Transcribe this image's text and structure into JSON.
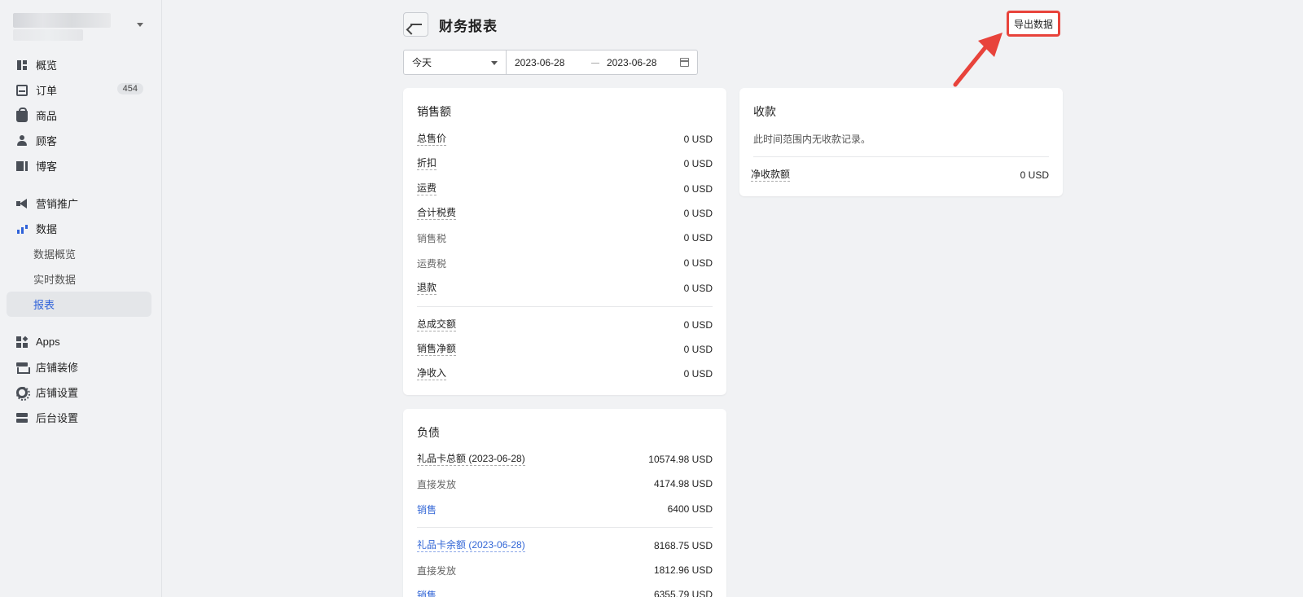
{
  "sidebar": {
    "badge_orders": "454",
    "items": [
      {
        "label": "概览"
      },
      {
        "label": "订单"
      },
      {
        "label": "商品"
      },
      {
        "label": "顾客"
      },
      {
        "label": "博客"
      },
      {
        "label": "营销推广"
      },
      {
        "label": "数据"
      },
      {
        "label": "数据概览"
      },
      {
        "label": "实时数据"
      },
      {
        "label": "报表"
      },
      {
        "label": "Apps"
      },
      {
        "label": "店铺装修"
      },
      {
        "label": "店铺设置"
      },
      {
        "label": "后台设置"
      }
    ]
  },
  "header": {
    "title": "财务报表",
    "export_label": "导出数据"
  },
  "filter": {
    "range": "今天",
    "start_date": "2023-06-28",
    "end_date": "2023-06-28"
  },
  "sales_card": {
    "title": "销售额",
    "rows": [
      {
        "label": "总售价",
        "value": "0 USD"
      },
      {
        "label": "折扣",
        "value": "0 USD"
      },
      {
        "label": "运费",
        "value": "0 USD"
      },
      {
        "label": "合计税费",
        "value": "0 USD"
      },
      {
        "label": "销售税",
        "value": "0 USD"
      },
      {
        "label": "运费税",
        "value": "0 USD"
      },
      {
        "label": "退款",
        "value": "0 USD"
      },
      {
        "label": "总成交额",
        "value": "0 USD"
      },
      {
        "label": "销售净额",
        "value": "0 USD"
      },
      {
        "label": "净收入",
        "value": "0 USD"
      }
    ]
  },
  "receipts_card": {
    "title": "收款",
    "empty_note": "此时间范围内无收款记录。",
    "net_label": "净收款额",
    "net_value": "0 USD"
  },
  "liabilities_card": {
    "title": "负债",
    "rows": [
      {
        "label": "礼品卡总额 (2023-06-28)",
        "value": "10574.98 USD"
      },
      {
        "label": "直接发放",
        "value": "4174.98 USD"
      },
      {
        "label": "销售",
        "value": "6400 USD"
      },
      {
        "label": "礼品卡余额 (2023-06-28)",
        "value": "8168.75 USD"
      },
      {
        "label": "直接发放",
        "value": "1812.96 USD"
      },
      {
        "label": "销售",
        "value": "6355.79 USD"
      }
    ]
  },
  "colors": {
    "accent": "#2f62d9",
    "highlight": "#e8433b"
  }
}
